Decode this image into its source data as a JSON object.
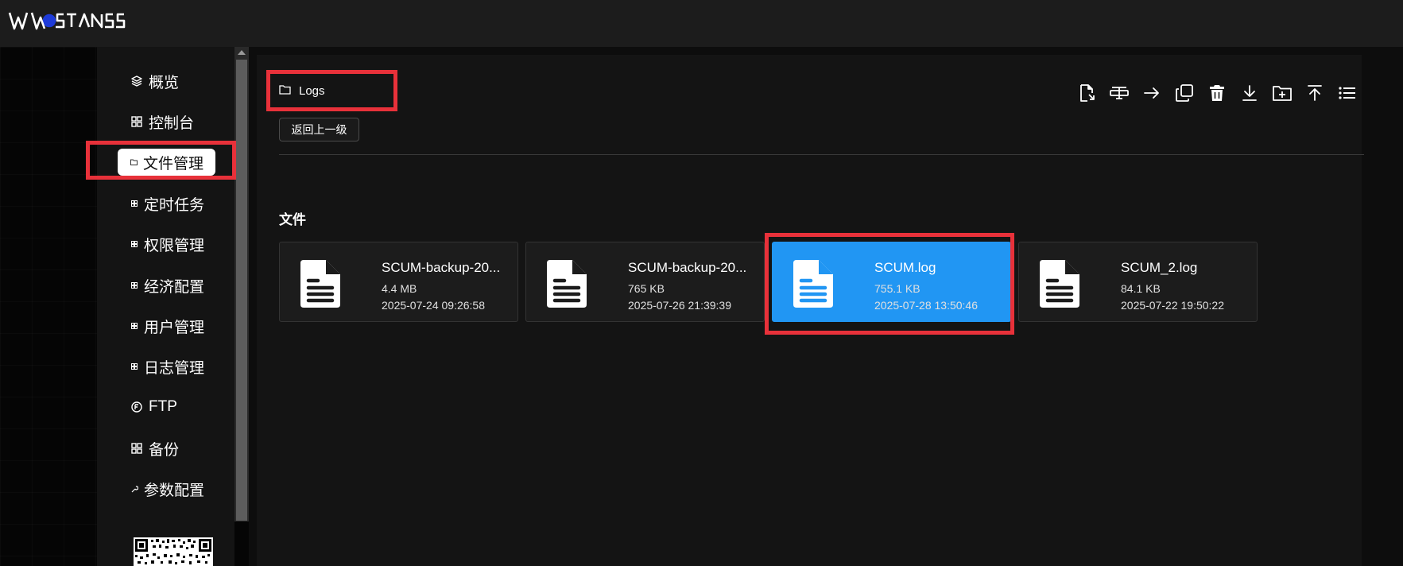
{
  "app": {
    "logo_text": "WOSTANSS"
  },
  "sidebar": {
    "items": [
      {
        "label": "概览",
        "icon": "layers-icon"
      },
      {
        "label": "控制台",
        "icon": "grid-icon"
      },
      {
        "label": "文件管理",
        "icon": "folder-icon",
        "active": true
      },
      {
        "label": "定时任务",
        "icon": "grid-icon"
      },
      {
        "label": "权限管理",
        "icon": "grid-icon"
      },
      {
        "label": "经济配置",
        "icon": "grid-icon"
      },
      {
        "label": "用户管理",
        "icon": "grid-icon"
      },
      {
        "label": "日志管理",
        "icon": "grid-icon"
      },
      {
        "label": "FTP",
        "icon": "ftp-icon"
      },
      {
        "label": "备份",
        "icon": "grid-icon"
      },
      {
        "label": "参数配置",
        "icon": "wrench-icon"
      }
    ]
  },
  "breadcrumb": {
    "folder": "Logs"
  },
  "actions": {
    "back_label": "返回上一级"
  },
  "toolbar": {
    "buttons": [
      "file-open-icon",
      "rename-icon",
      "move-icon",
      "copy-icon",
      "delete-icon",
      "download-icon",
      "new-folder-icon",
      "upload-icon",
      "list-view-icon"
    ]
  },
  "files_section": {
    "title": "文件",
    "files": [
      {
        "name": "SCUM-backup-20...",
        "size": "4.4 MB",
        "date": "2025-07-24 09:26:58",
        "selected": false
      },
      {
        "name": "SCUM-backup-20...",
        "size": "765 KB",
        "date": "2025-07-26 21:39:39",
        "selected": false
      },
      {
        "name": "SCUM.log",
        "size": "755.1 KB",
        "date": "2025-07-28 13:50:46",
        "selected": true
      },
      {
        "name": "SCUM_2.log",
        "size": "84.1 KB",
        "date": "2025-07-22 19:50:22",
        "selected": false
      }
    ]
  },
  "colors": {
    "accent": "#2196f3",
    "highlight": "#e8313a",
    "sidebar_bg": "#141414",
    "main_bg": "#141414"
  }
}
